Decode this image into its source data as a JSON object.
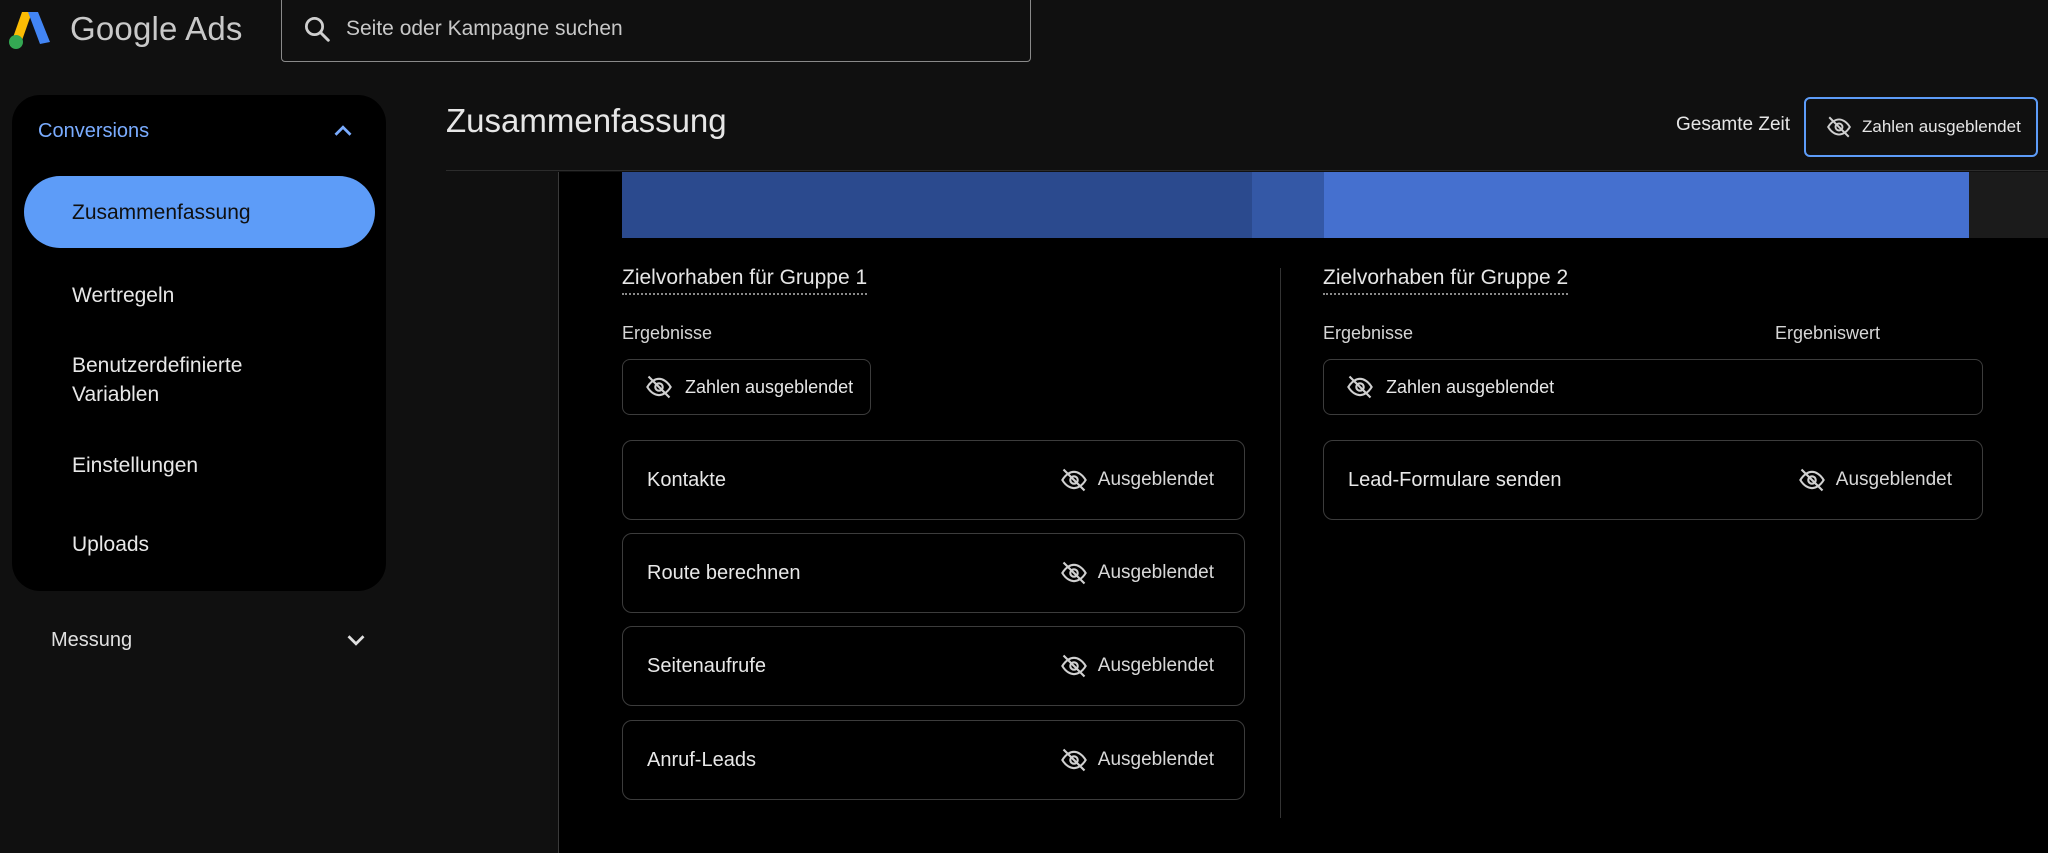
{
  "header": {
    "product_name": "Google Ads",
    "search_placeholder": "Seite oder Kampagne suchen"
  },
  "sidebar": {
    "section_conversions": "Conversions",
    "items": [
      {
        "label": "Zusammenfassung"
      },
      {
        "label": "Wertregeln"
      },
      {
        "label": "Benutzerdefinierte Variablen"
      },
      {
        "label": "Einstellungen"
      },
      {
        "label": "Uploads"
      }
    ],
    "section_measurement": "Messung"
  },
  "main": {
    "title": "Zusammenfassung",
    "time_range": "Gesamte Zeit",
    "hidden_toggle": "Zahlen ausgeblendet"
  },
  "group1": {
    "title": "Zielvorhaben für Gruppe 1",
    "results_label": "Ergebnisse",
    "hidden_pill": "Zahlen ausgeblendet",
    "rows": [
      {
        "name": "Kontakte",
        "status": "Ausgeblendet"
      },
      {
        "name": "Route berechnen",
        "status": "Ausgeblendet"
      },
      {
        "name": "Seitenaufrufe",
        "status": "Ausgeblendet"
      },
      {
        "name": "Anruf-Leads",
        "status": "Ausgeblendet"
      }
    ]
  },
  "group2": {
    "title": "Zielvorhaben für Gruppe 2",
    "results_label": "Ergebnisse",
    "value_label": "Ergebniswert",
    "hidden_pill": "Zahlen ausgeblendet",
    "rows": [
      {
        "name": "Lead-Formulare senden",
        "status": "Ausgeblendet"
      }
    ]
  },
  "colors": {
    "accent": "#5d9cf8",
    "bar_dark": "#2b4a8e",
    "bar_light": "#4570cf"
  }
}
